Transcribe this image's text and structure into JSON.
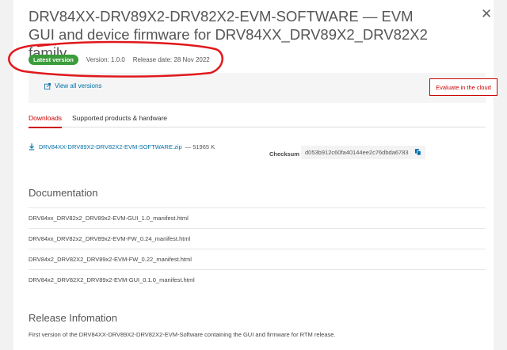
{
  "page": {
    "title": "DRV84XX-DRV89X2-DRV82X2-EVM-SOFTWARE — EVM GUI and device firmware for DRV84XX_DRV89X2_DRV82X2 family",
    "badge": "Latest version",
    "version": "Version: 1.0.0",
    "release_date": "Release date: 28 Nov 2022",
    "view_all": "View all versions",
    "evaluate_button": "Evaluate in the cloud"
  },
  "tabs": [
    {
      "label": "Downloads",
      "active": true
    },
    {
      "label": "Supported products & hardware",
      "active": false
    }
  ],
  "download": {
    "file": "DRV84XX-DRV89X2-DRV82X2-EVM-SOFTWARE.zip",
    "size": "— 51965 K",
    "checksum_label": "Checksum",
    "checksum_value": "d053b912c60fa40144ee2c76dbda6783"
  },
  "documentation": {
    "title": "Documentation",
    "items": [
      "DRV84xx_DRV82x2_DRV89x2-EVM-GUI_1.0_manifest.html",
      "DRV84xx_DRV82x2_DRV89x2-EVM-FW_0.24_manifest.html",
      "DRV84x2_DRV82X2_DRV89x2-EVM-FW_0.22_manifest.html",
      "DRV84x2_DRV82X2_DRV89x2-EVM-GUI_0.1.0_manifest.html"
    ]
  },
  "release": {
    "title": "Release Infomation",
    "text": "First version of the DRV84XX-DRV89X2-DRV82X2-EVM-Software containing the GUI and firmware for RTM release."
  },
  "colors": {
    "accent": "#cc0000",
    "link": "#0070a8",
    "badge": "#3a9c3a",
    "annotation": "#e0181c"
  }
}
